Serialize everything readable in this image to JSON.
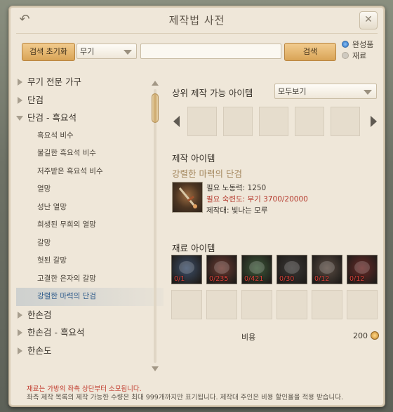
{
  "window": {
    "title": "제작법 사전"
  },
  "search": {
    "reset_label": "검색 초기화",
    "category_value": "무기",
    "search_label": "검색",
    "options": [
      {
        "label": "완성품",
        "selected": true
      },
      {
        "label": "재료",
        "selected": false
      }
    ]
  },
  "tree": [
    {
      "label": "무기 전문 가구",
      "type": "cat",
      "expanded": false
    },
    {
      "label": "단검",
      "type": "cat",
      "expanded": false
    },
    {
      "label": "단검 - 흑요석",
      "type": "cat",
      "expanded": true
    },
    {
      "label": "흑요석 비수",
      "type": "sub"
    },
    {
      "label": "불길한 흑요석 비수",
      "type": "sub"
    },
    {
      "label": "저주받은 흑요석 비수",
      "type": "sub"
    },
    {
      "label": "열망",
      "type": "sub"
    },
    {
      "label": "성난 열망",
      "type": "sub"
    },
    {
      "label": "희생된 무희의 열망",
      "type": "sub"
    },
    {
      "label": "갈망",
      "type": "sub"
    },
    {
      "label": "헛된 갈망",
      "type": "sub"
    },
    {
      "label": "고결한 은자의 갈망",
      "type": "sub"
    },
    {
      "label": "강렬한 마력의 단검",
      "type": "sub",
      "selected": true
    },
    {
      "label": "한손검",
      "type": "cat",
      "expanded": false
    },
    {
      "label": "한손검 - 흑요석",
      "type": "cat",
      "expanded": false
    },
    {
      "label": "한손도",
      "type": "cat",
      "expanded": false
    }
  ],
  "upper": {
    "label": "상위 제작 가능 아이템",
    "filter_value": "모두보기"
  },
  "craft": {
    "section_label": "제작 아이템",
    "item_name": "강렬한 마력의 단검",
    "labor": "필요 노동력: 1250",
    "proficiency": "필요 숙련도: 무기 3700/20000",
    "station": "제작대: 빛나는 모루"
  },
  "materials": {
    "section_label": "재료 아이템",
    "items": [
      {
        "count": "0/1",
        "icon": "blue-crystal-icon",
        "color": "#3d4f6a"
      },
      {
        "count": "0/235",
        "icon": "red-potion-icon",
        "color": "#6d3b32"
      },
      {
        "count": "0/421",
        "icon": "green-orb-icon",
        "color": "#3d5a3a"
      },
      {
        "count": "0/30",
        "icon": "dark-ore-icon",
        "color": "#3b3836"
      },
      {
        "count": "0/12",
        "icon": "fang-icon",
        "color": "#5c4d44"
      },
      {
        "count": "0/12",
        "icon": "red-scale-icon",
        "color": "#6a2a28"
      }
    ]
  },
  "cost": {
    "label": "비용",
    "value": "200"
  },
  "footer": {
    "line1": "재료는 가방의 좌측 상단부터 소모됩니다.",
    "line2": "좌측 제작 목록의 제작 가능한 수량은 최대 999개까지만 표기됩니다. 제작대 주인은 비용 할인율을 적용 받습니다."
  }
}
